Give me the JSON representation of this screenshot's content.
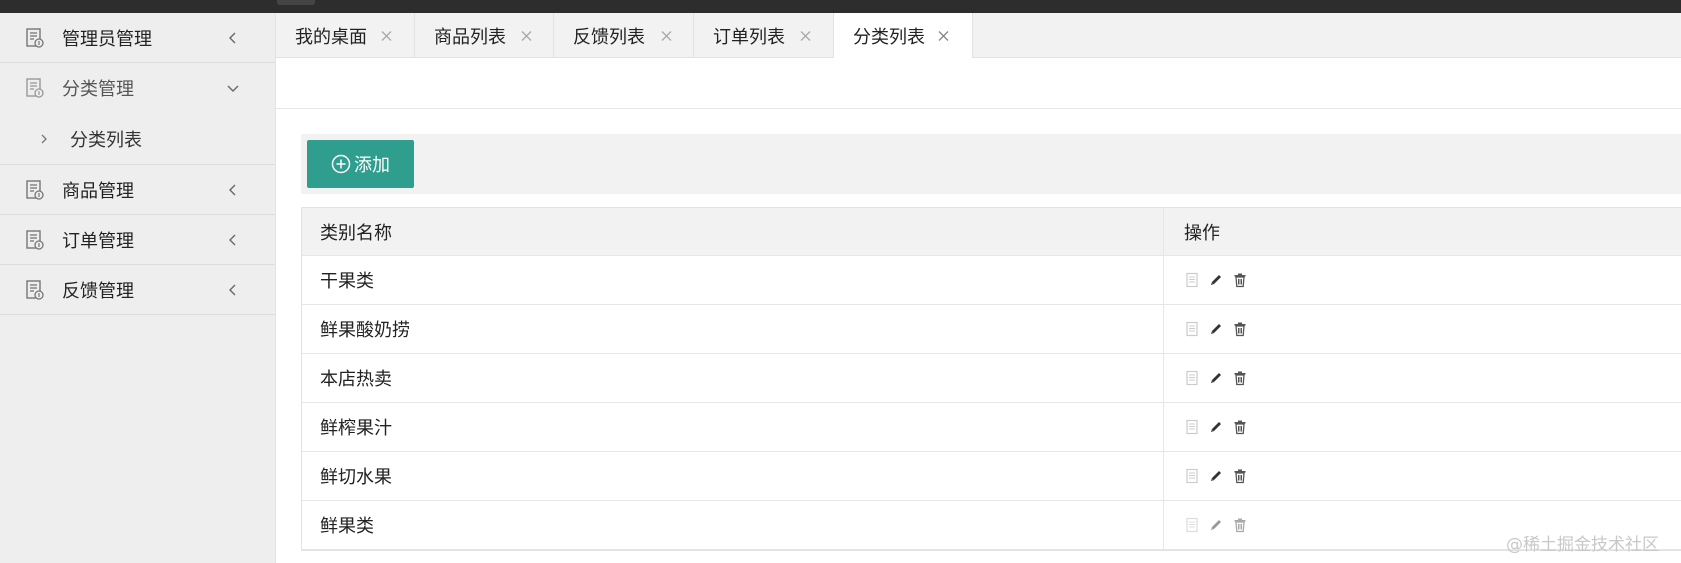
{
  "sidebar": {
    "items": [
      {
        "label": "管理员管理",
        "icon": "admin-doc-icon",
        "expanded": false
      },
      {
        "label": "分类管理",
        "icon": "category-doc-icon",
        "expanded": true,
        "children": [
          {
            "label": "分类列表"
          }
        ]
      },
      {
        "label": "商品管理",
        "icon": "goods-doc-icon",
        "expanded": false
      },
      {
        "label": "订单管理",
        "icon": "order-doc-icon",
        "expanded": false
      },
      {
        "label": "反馈管理",
        "icon": "feedback-doc-icon",
        "expanded": false
      }
    ]
  },
  "tabs": [
    {
      "label": "我的桌面",
      "active": false
    },
    {
      "label": "商品列表",
      "active": false
    },
    {
      "label": "反馈列表",
      "active": false
    },
    {
      "label": "订单列表",
      "active": false
    },
    {
      "label": "分类列表",
      "active": true
    }
  ],
  "toolbar": {
    "add_label": "添加",
    "add_icon": "plus-circle-icon",
    "accent": "#2f9e8f"
  },
  "table": {
    "columns": [
      "类别名称",
      "操作"
    ],
    "rows": [
      {
        "name": "干果类"
      },
      {
        "name": "鲜果酸奶捞"
      },
      {
        "name": "本店热卖"
      },
      {
        "name": "鲜榨果汁"
      },
      {
        "name": "鲜切水果"
      },
      {
        "name": "鲜果类"
      }
    ],
    "row_actions": [
      "view-icon",
      "edit-icon",
      "delete-icon"
    ]
  },
  "watermark": "@稀土掘金技术社区"
}
